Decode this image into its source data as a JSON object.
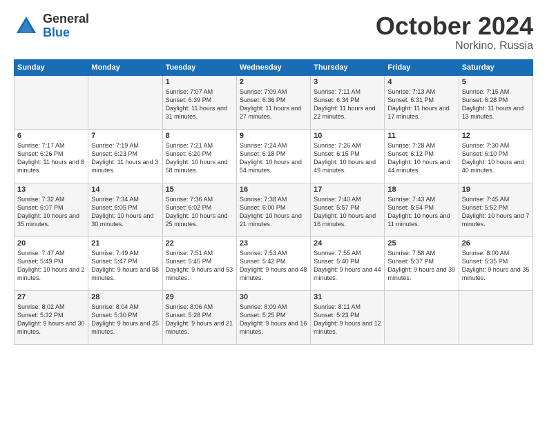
{
  "logo": {
    "general": "General",
    "blue": "Blue"
  },
  "title": "October 2024",
  "location": "Norkino, Russia",
  "days_of_week": [
    "Sunday",
    "Monday",
    "Tuesday",
    "Wednesday",
    "Thursday",
    "Friday",
    "Saturday"
  ],
  "weeks": [
    [
      {
        "day": "",
        "sunrise": "",
        "sunset": "",
        "daylight": ""
      },
      {
        "day": "",
        "sunrise": "",
        "sunset": "",
        "daylight": ""
      },
      {
        "day": "1",
        "sunrise": "Sunrise: 7:07 AM",
        "sunset": "Sunset: 6:39 PM",
        "daylight": "Daylight: 11 hours and 31 minutes."
      },
      {
        "day": "2",
        "sunrise": "Sunrise: 7:09 AM",
        "sunset": "Sunset: 6:36 PM",
        "daylight": "Daylight: 11 hours and 27 minutes."
      },
      {
        "day": "3",
        "sunrise": "Sunrise: 7:11 AM",
        "sunset": "Sunset: 6:34 PM",
        "daylight": "Daylight: 11 hours and 22 minutes."
      },
      {
        "day": "4",
        "sunrise": "Sunrise: 7:13 AM",
        "sunset": "Sunset: 6:31 PM",
        "daylight": "Daylight: 11 hours and 17 minutes."
      },
      {
        "day": "5",
        "sunrise": "Sunrise: 7:15 AM",
        "sunset": "Sunset: 6:28 PM",
        "daylight": "Daylight: 11 hours and 13 minutes."
      }
    ],
    [
      {
        "day": "6",
        "sunrise": "Sunrise: 7:17 AM",
        "sunset": "Sunset: 6:26 PM",
        "daylight": "Daylight: 11 hours and 8 minutes."
      },
      {
        "day": "7",
        "sunrise": "Sunrise: 7:19 AM",
        "sunset": "Sunset: 6:23 PM",
        "daylight": "Daylight: 11 hours and 3 minutes."
      },
      {
        "day": "8",
        "sunrise": "Sunrise: 7:21 AM",
        "sunset": "Sunset: 6:20 PM",
        "daylight": "Daylight: 10 hours and 58 minutes."
      },
      {
        "day": "9",
        "sunrise": "Sunrise: 7:24 AM",
        "sunset": "Sunset: 6:18 PM",
        "daylight": "Daylight: 10 hours and 54 minutes."
      },
      {
        "day": "10",
        "sunrise": "Sunrise: 7:26 AM",
        "sunset": "Sunset: 6:15 PM",
        "daylight": "Daylight: 10 hours and 49 minutes."
      },
      {
        "day": "11",
        "sunrise": "Sunrise: 7:28 AM",
        "sunset": "Sunset: 6:12 PM",
        "daylight": "Daylight: 10 hours and 44 minutes."
      },
      {
        "day": "12",
        "sunrise": "Sunrise: 7:30 AM",
        "sunset": "Sunset: 6:10 PM",
        "daylight": "Daylight: 10 hours and 40 minutes."
      }
    ],
    [
      {
        "day": "13",
        "sunrise": "Sunrise: 7:32 AM",
        "sunset": "Sunset: 6:07 PM",
        "daylight": "Daylight: 10 hours and 35 minutes."
      },
      {
        "day": "14",
        "sunrise": "Sunrise: 7:34 AM",
        "sunset": "Sunset: 6:05 PM",
        "daylight": "Daylight: 10 hours and 30 minutes."
      },
      {
        "day": "15",
        "sunrise": "Sunrise: 7:36 AM",
        "sunset": "Sunset: 6:02 PM",
        "daylight": "Daylight: 10 hours and 25 minutes."
      },
      {
        "day": "16",
        "sunrise": "Sunrise: 7:38 AM",
        "sunset": "Sunset: 6:00 PM",
        "daylight": "Daylight: 10 hours and 21 minutes."
      },
      {
        "day": "17",
        "sunrise": "Sunrise: 7:40 AM",
        "sunset": "Sunset: 5:57 PM",
        "daylight": "Daylight: 10 hours and 16 minutes."
      },
      {
        "day": "18",
        "sunrise": "Sunrise: 7:43 AM",
        "sunset": "Sunset: 5:54 PM",
        "daylight": "Daylight: 10 hours and 11 minutes."
      },
      {
        "day": "19",
        "sunrise": "Sunrise: 7:45 AM",
        "sunset": "Sunset: 5:52 PM",
        "daylight": "Daylight: 10 hours and 7 minutes."
      }
    ],
    [
      {
        "day": "20",
        "sunrise": "Sunrise: 7:47 AM",
        "sunset": "Sunset: 5:49 PM",
        "daylight": "Daylight: 10 hours and 2 minutes."
      },
      {
        "day": "21",
        "sunrise": "Sunrise: 7:49 AM",
        "sunset": "Sunset: 5:47 PM",
        "daylight": "Daylight: 9 hours and 58 minutes."
      },
      {
        "day": "22",
        "sunrise": "Sunrise: 7:51 AM",
        "sunset": "Sunset: 5:45 PM",
        "daylight": "Daylight: 9 hours and 53 minutes."
      },
      {
        "day": "23",
        "sunrise": "Sunrise: 7:53 AM",
        "sunset": "Sunset: 5:42 PM",
        "daylight": "Daylight: 9 hours and 48 minutes."
      },
      {
        "day": "24",
        "sunrise": "Sunrise: 7:55 AM",
        "sunset": "Sunset: 5:40 PM",
        "daylight": "Daylight: 9 hours and 44 minutes."
      },
      {
        "day": "25",
        "sunrise": "Sunrise: 7:58 AM",
        "sunset": "Sunset: 5:37 PM",
        "daylight": "Daylight: 9 hours and 39 minutes."
      },
      {
        "day": "26",
        "sunrise": "Sunrise: 8:00 AM",
        "sunset": "Sunset: 5:35 PM",
        "daylight": "Daylight: 9 hours and 35 minutes."
      }
    ],
    [
      {
        "day": "27",
        "sunrise": "Sunrise: 8:02 AM",
        "sunset": "Sunset: 5:32 PM",
        "daylight": "Daylight: 9 hours and 30 minutes."
      },
      {
        "day": "28",
        "sunrise": "Sunrise: 8:04 AM",
        "sunset": "Sunset: 5:30 PM",
        "daylight": "Daylight: 9 hours and 25 minutes."
      },
      {
        "day": "29",
        "sunrise": "Sunrise: 8:06 AM",
        "sunset": "Sunset: 5:28 PM",
        "daylight": "Daylight: 9 hours and 21 minutes."
      },
      {
        "day": "30",
        "sunrise": "Sunrise: 8:09 AM",
        "sunset": "Sunset: 5:25 PM",
        "daylight": "Daylight: 9 hours and 16 minutes."
      },
      {
        "day": "31",
        "sunrise": "Sunrise: 8:11 AM",
        "sunset": "Sunset: 5:23 PM",
        "daylight": "Daylight: 9 hours and 12 minutes."
      },
      {
        "day": "",
        "sunrise": "",
        "sunset": "",
        "daylight": ""
      },
      {
        "day": "",
        "sunrise": "",
        "sunset": "",
        "daylight": ""
      }
    ]
  ]
}
